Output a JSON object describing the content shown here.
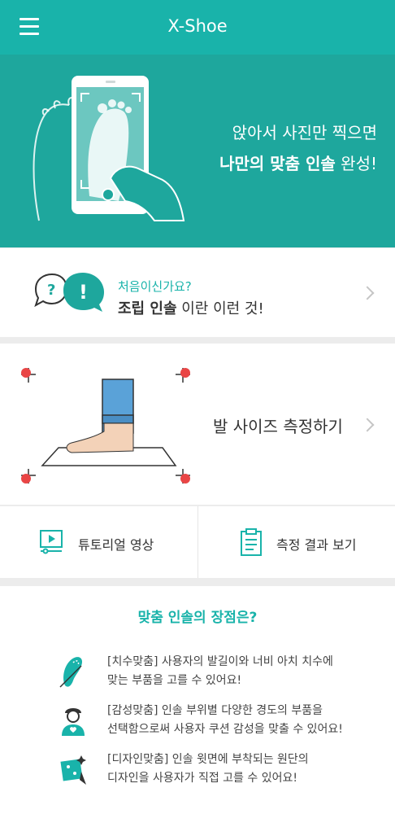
{
  "header": {
    "title": "X-Shoe",
    "menu_icon": "hamburger-menu-icon"
  },
  "hero": {
    "line1": "앉아서 사진만 찍으면",
    "line2_bold": "나만의 맞춤 인솔",
    "line2_rest": " 완성!"
  },
  "intro": {
    "question": "처음이신가요?",
    "main_bold": "조립 인솔",
    "main_rest": "이란 이런 것!",
    "bubble_q": "?",
    "bubble_ex": "!"
  },
  "measure": {
    "label": "발 사이즈 측정하기"
  },
  "actions": {
    "tutorial_label": "튜토리얼 영상",
    "results_label": "측정 결과 보기"
  },
  "benefits": {
    "title": "맞춤 인솔의 장점은?",
    "items": [
      {
        "line1": "[치수맞춤] 사용자의 발길이와 너비 아치 치수에",
        "line2": "맞는 부품을 고를 수 있어요!"
      },
      {
        "line1": "[감성맞춤] 인솔 부위별 다양한 경도의 부품을",
        "line2": "선택함으로써 사용자 쿠션 감성을 맞출 수 있어요!"
      },
      {
        "line1": "[디자인맞춤] 인솔 윗면에 부착되는 원단의",
        "line2": "디자인을 사용자가 직접 고를 수 있어요!"
      }
    ]
  },
  "colors": {
    "accent": "#19b3aa",
    "hero": "#1ea79d",
    "marker": "#e94545"
  }
}
